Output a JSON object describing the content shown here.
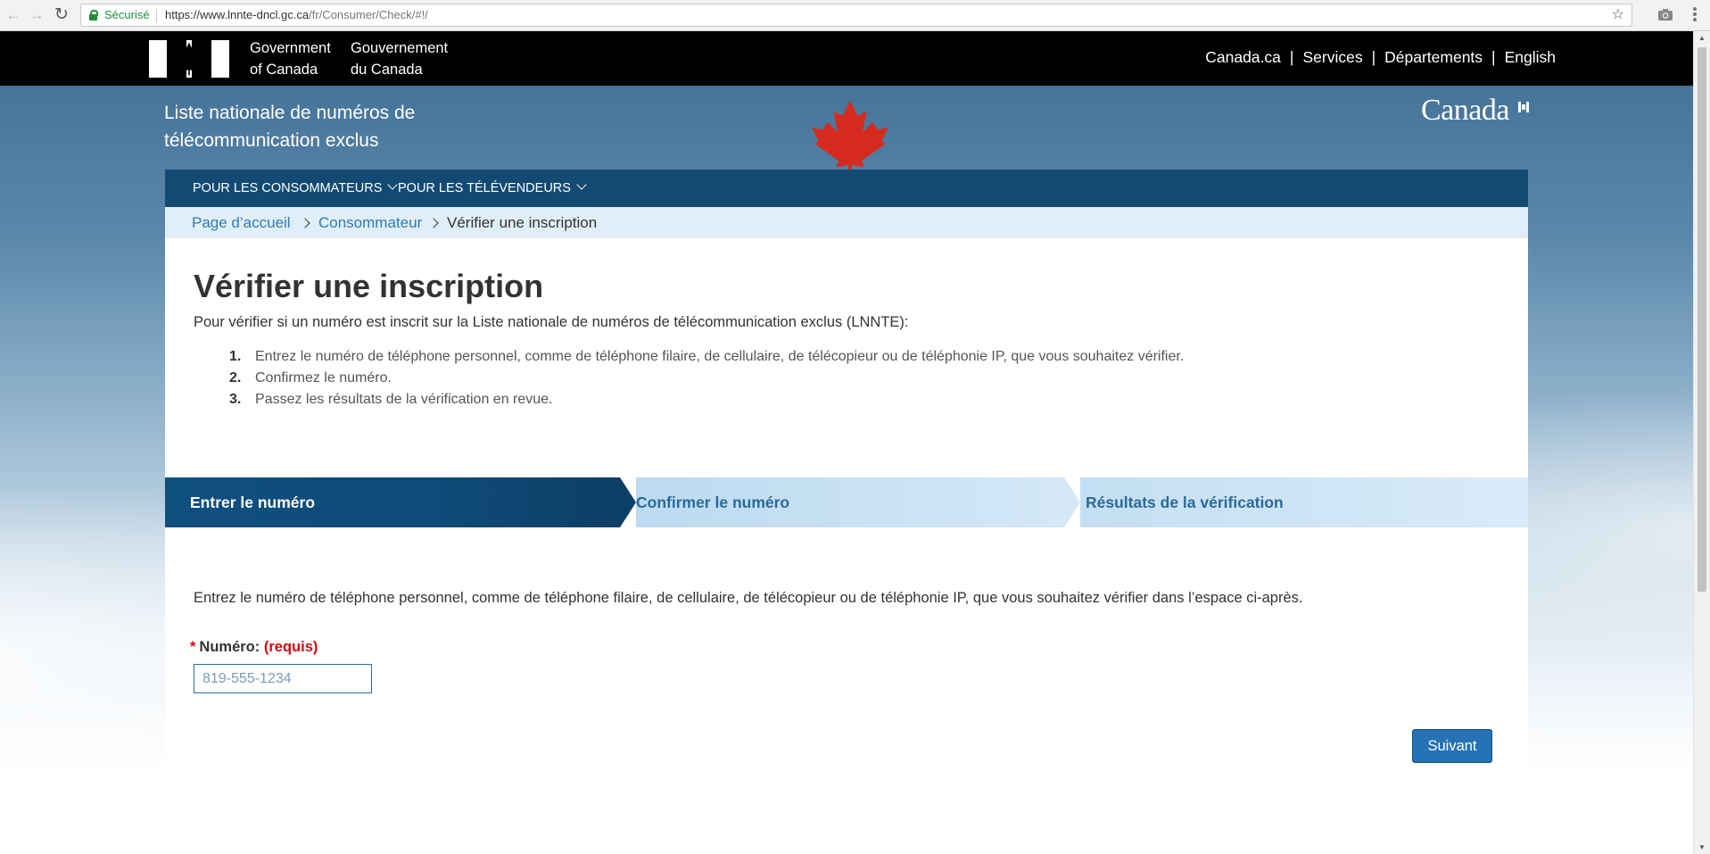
{
  "browser": {
    "secure_label": "Sécurisé",
    "url_host": "https://www.lnnte-dncl.gc.ca",
    "url_path": "/fr/Consumer/Check/#!/"
  },
  "gc_header": {
    "name_en_line1": "Government",
    "name_en_line2": "of Canada",
    "name_fr_line1": "Gouvernement",
    "name_fr_line2": "du Canada",
    "menu": [
      "Canada.ca",
      "Services",
      "Départements",
      "English"
    ],
    "menu_separator": "|"
  },
  "site": {
    "title_line1": "Liste nationale de numéros de",
    "title_line2": "télécommunication exclus",
    "wordmark": "Canada"
  },
  "main_nav": [
    {
      "label": "POUR LES CONSOMMATEURS"
    },
    {
      "label": "POUR LES TÉLÉVENDEURS"
    }
  ],
  "breadcrumb": [
    {
      "label": "Page d’accueil"
    },
    {
      "label": "Consommateur"
    },
    {
      "label": "Vérifier une inscription"
    }
  ],
  "page": {
    "title": "Vérifier une inscription",
    "intro": "Pour vérifier si un numéro est inscrit sur la Liste nationale de numéros de télécommunication exclus (LNNTE):",
    "steps": [
      {
        "num": "1.",
        "text": "Entrez le numéro de téléphone personnel, comme de téléphone filaire, de cellulaire, de télécopieur ou de téléphonie IP, que vous souhaitez vérifier."
      },
      {
        "num": "2.",
        "text": "Confirmez le numéro."
      },
      {
        "num": "3.",
        "text": "Passez les résultats de la vérification en revue."
      }
    ]
  },
  "wizard": {
    "steps": [
      {
        "label": "Entrer le numéro",
        "state": "active"
      },
      {
        "label": "Confirmer le numéro",
        "state": "upcoming"
      },
      {
        "label": "Résultats de la vérification",
        "state": "upcoming"
      }
    ]
  },
  "form": {
    "instructions": "Entrez le numéro de téléphone personnel, comme de téléphone filaire, de cellulaire, de télécopieur ou de téléphonie IP, que vous souhaitez vérifier dans l’espace ci-après.",
    "asterisk": "*",
    "field_label": "Numéro:",
    "required_label": "(requis)",
    "phone_value": "",
    "phone_placeholder": "819-555-1234",
    "next_button": "Suivant"
  },
  "colors": {
    "gc_black": "#000000",
    "nav_blue": "#124a73",
    "breadcrumb_bg": "#e0eef8",
    "link_blue": "#2f7cb0",
    "required_red": "#d3080c",
    "button_blue": "#2572b4",
    "leaf_red": "#d52b1e"
  }
}
